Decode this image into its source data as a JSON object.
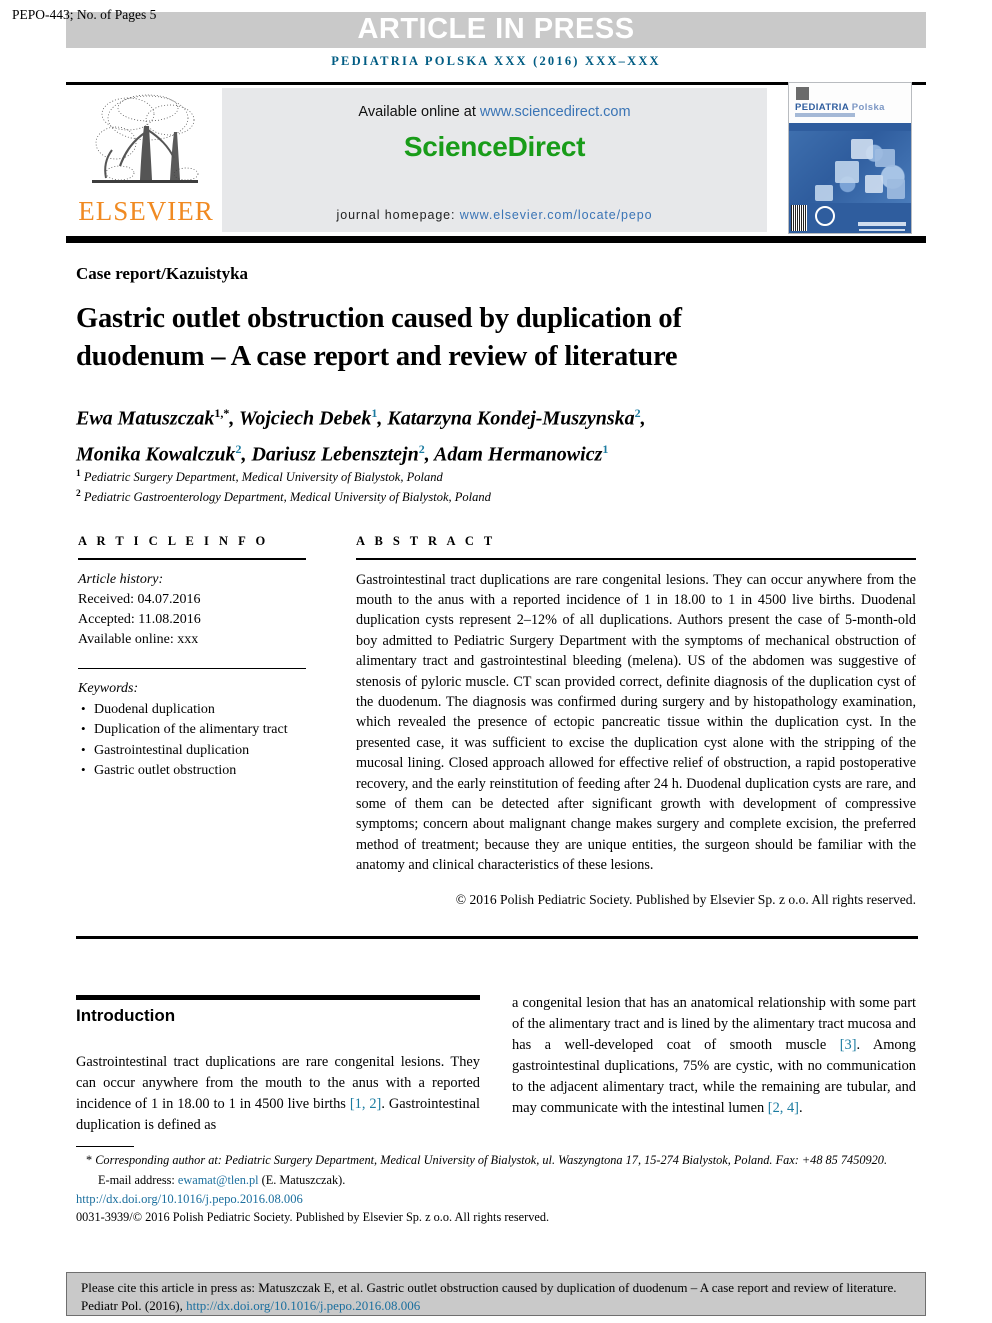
{
  "header": {
    "manuscript_id": "PEPO-443; No. of Pages 5",
    "article_in_press": "ARTICLE IN PRESS",
    "journal_citation_line": "PEDIATRIA POLSKA XXX (2016) XXX–XXX",
    "accent_blue": "#005c83"
  },
  "masthead": {
    "available_online_prefix": "Available online at ",
    "available_online_url": "www.sciencedirect.com",
    "sciencedirect_logo": "ScienceDirect",
    "sciencedirect_green": "#199c19",
    "homepage_prefix": "journal homepage: ",
    "homepage_url": "www.elsevier.com/locate/pepo",
    "elsevier_wordmark": "ELSEVIER",
    "elsevier_orange": "#f08a22",
    "cover_title_main": "PEDIATRIA",
    "cover_title_light": "Polska"
  },
  "article": {
    "section_label": "Case report/Kazuistyka",
    "title_line1": "Gastric outlet obstruction caused by duplication of",
    "title_line2": "duodenum – A case report and review of literature",
    "affiliation_1": "Pediatric Surgery Department, Medical University of Bialystok, Poland",
    "affiliation_2": "Pediatric Gastroenterology Department, Medical University of Bialystok, Poland"
  },
  "authors": [
    {
      "name": "Ewa Matuszczak",
      "sup": "1,*"
    },
    {
      "name": "Wojciech Debek",
      "sup": "1"
    },
    {
      "name": "Katarzyna Kondej-Muszynska",
      "sup": "2"
    },
    {
      "name": "Monika Kowalczuk",
      "sup": "2"
    },
    {
      "name": "Dariusz Lebensztejn",
      "sup": "2"
    },
    {
      "name": "Adam Hermanowicz",
      "sup": "1"
    }
  ],
  "article_info": {
    "heading": "A R T I C L E  I N F O",
    "history_label": "Article history:",
    "received": "Received: 04.07.2016",
    "accepted": "Accepted: 11.08.2016",
    "available_online": "Available online: xxx",
    "keywords_label": "Keywords:",
    "keywords": [
      "Duodenal duplication",
      "Duplication of the alimentary tract",
      "Gastrointestinal duplication",
      "Gastric outlet obstruction"
    ]
  },
  "abstract": {
    "heading": "A B S T R A C T",
    "body": "Gastrointestinal tract duplications are rare congenital lesions. They can occur anywhere from the mouth to the anus with a reported incidence of 1 in 18.00 to 1 in 4500 live births. Duodenal duplication cysts represent 2–12% of all duplications. Authors present the case of 5-month-old boy admitted to Pediatric Surgery Department with the symptoms of mechanical obstruction of alimentary tract and gastrointestinal bleeding (melena). US of the abdomen was suggestive of stenosis of pyloric muscle. CT scan provided correct, definite diagnosis of the duplication cyst of the duodenum. The diagnosis was confirmed during surgery and by histopathology examination, which revealed the presence of ectopic pancreatic tissue within the duplication cyst. In the presented case, it was sufficient to excise the duplication cyst alone with the stripping of the mucosal lining. Closed approach allowed for effective relief of obstruction, a rapid postoperative recovery, and the early reinstitution of feeding after 24 h. Duodenal duplication cysts are rare, and some of them can be detected after significant growth with development of compressive symptoms; concern about malignant change makes surgery and complete excision, the preferred method of treatment; because they are unique entities, the surgeon should be familiar with the anatomy and clinical characteristics of these lesions.",
    "copyright": "© 2016 Polish Pediatric Society. Published by Elsevier Sp. z o.o. All rights reserved."
  },
  "introduction": {
    "heading": "Introduction",
    "left_part1": "Gastrointestinal tract duplications are rare congenital lesions. They can occur anywhere from the mouth to the anus with a reported incidence of 1 in 18.00 to 1 in 4500 live births ",
    "left_ref1": "[1, 2]",
    "left_part2": ". Gastrointestinal duplication is defined as",
    "right_part1": "a congenital lesion that has an anatomical relationship with some part of the alimentary tract and is lined by the alimentary tract mucosa and has a well-developed coat of smooth muscle ",
    "right_ref1": "[3]",
    "right_part2": ". Among gastrointestinal duplications, 75% are cystic, with no communication to the adjacent alimentary tract, while the remaining are tubular, and may communicate with the intestinal lumen ",
    "right_ref2": "[2, 4]",
    "right_part3": "."
  },
  "footnotes": {
    "corresponding_italic": "Corresponding author at: Pediatric Surgery Department, Medical University of Bialystok, ul. Waszyngtona 17, 15-274 Bialystok, Poland. Fax: +48 85 7450920.",
    "email_label": "E-mail address: ",
    "email": "ewamat@tlen.pl",
    "email_suffix": " (E. Matuszczak).",
    "doi": "http://dx.doi.org/10.1016/j.pepo.2016.08.006",
    "issn_line": "0031-3939/© 2016 Polish Pediatric Society. Published by Elsevier Sp. z o.o. All rights reserved.",
    "link_blue": "#1b6f9e"
  },
  "cite_box": {
    "text_before_link": "Please cite this article in press as: Matuszczak E, et al. Gastric outlet obstruction caused by duplication of duodenum – A case report and review of literature. Pediatr Pol. (2016), ",
    "link": "http://dx.doi.org/10.1016/j.pepo.2016.08.006"
  }
}
